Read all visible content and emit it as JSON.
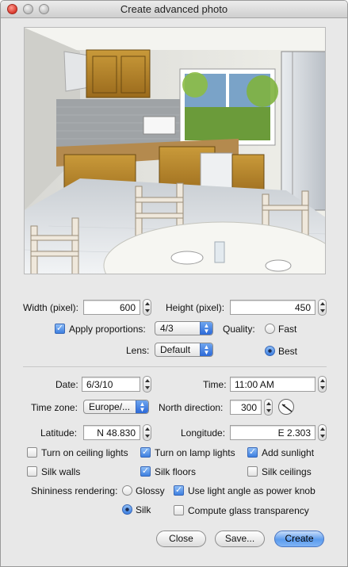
{
  "window": {
    "title": "Create advanced photo"
  },
  "size": {
    "width_label": "Width (pixel):",
    "width_value": "600",
    "height_label": "Height (pixel):",
    "height_value": "450",
    "apply_proportions_label": "Apply proportions:",
    "apply_proportions_checked": true,
    "proportions_value": "4/3",
    "quality_label": "Quality:",
    "quality_fast": "Fast",
    "quality_best": "Best",
    "quality_selected": "Best",
    "lens_label": "Lens:",
    "lens_value": "Default"
  },
  "sun": {
    "date_label": "Date:",
    "date_value": "6/3/10",
    "time_label": "Time:",
    "time_value": "11:00 AM",
    "timezone_label": "Time zone:",
    "timezone_value": "Europe/...",
    "north_label": "North direction:",
    "north_value": "300",
    "latitude_label": "Latitude:",
    "latitude_value": "N 48.830",
    "longitude_label": "Longitude:",
    "longitude_value": "E 2.303"
  },
  "options": {
    "ceiling_lights": {
      "label": "Turn on ceiling lights",
      "checked": false
    },
    "lamp_lights": {
      "label": "Turn on lamp lights",
      "checked": true
    },
    "sunlight": {
      "label": "Add sunlight",
      "checked": true
    },
    "silk_walls": {
      "label": "Silk walls",
      "checked": false
    },
    "silk_floors": {
      "label": "Silk floors",
      "checked": true
    },
    "silk_ceilings": {
      "label": "Silk ceilings",
      "checked": false
    },
    "shininess_label": "Shininess rendering:",
    "glossy": "Glossy",
    "silk": "Silk",
    "shininess_selected": "Silk",
    "light_angle": {
      "label": "Use light angle as power knob",
      "checked": true
    },
    "glass_transparency": {
      "label": "Compute glass transparency",
      "checked": false
    }
  },
  "buttons": {
    "close": "Close",
    "save": "Save...",
    "create": "Create"
  }
}
